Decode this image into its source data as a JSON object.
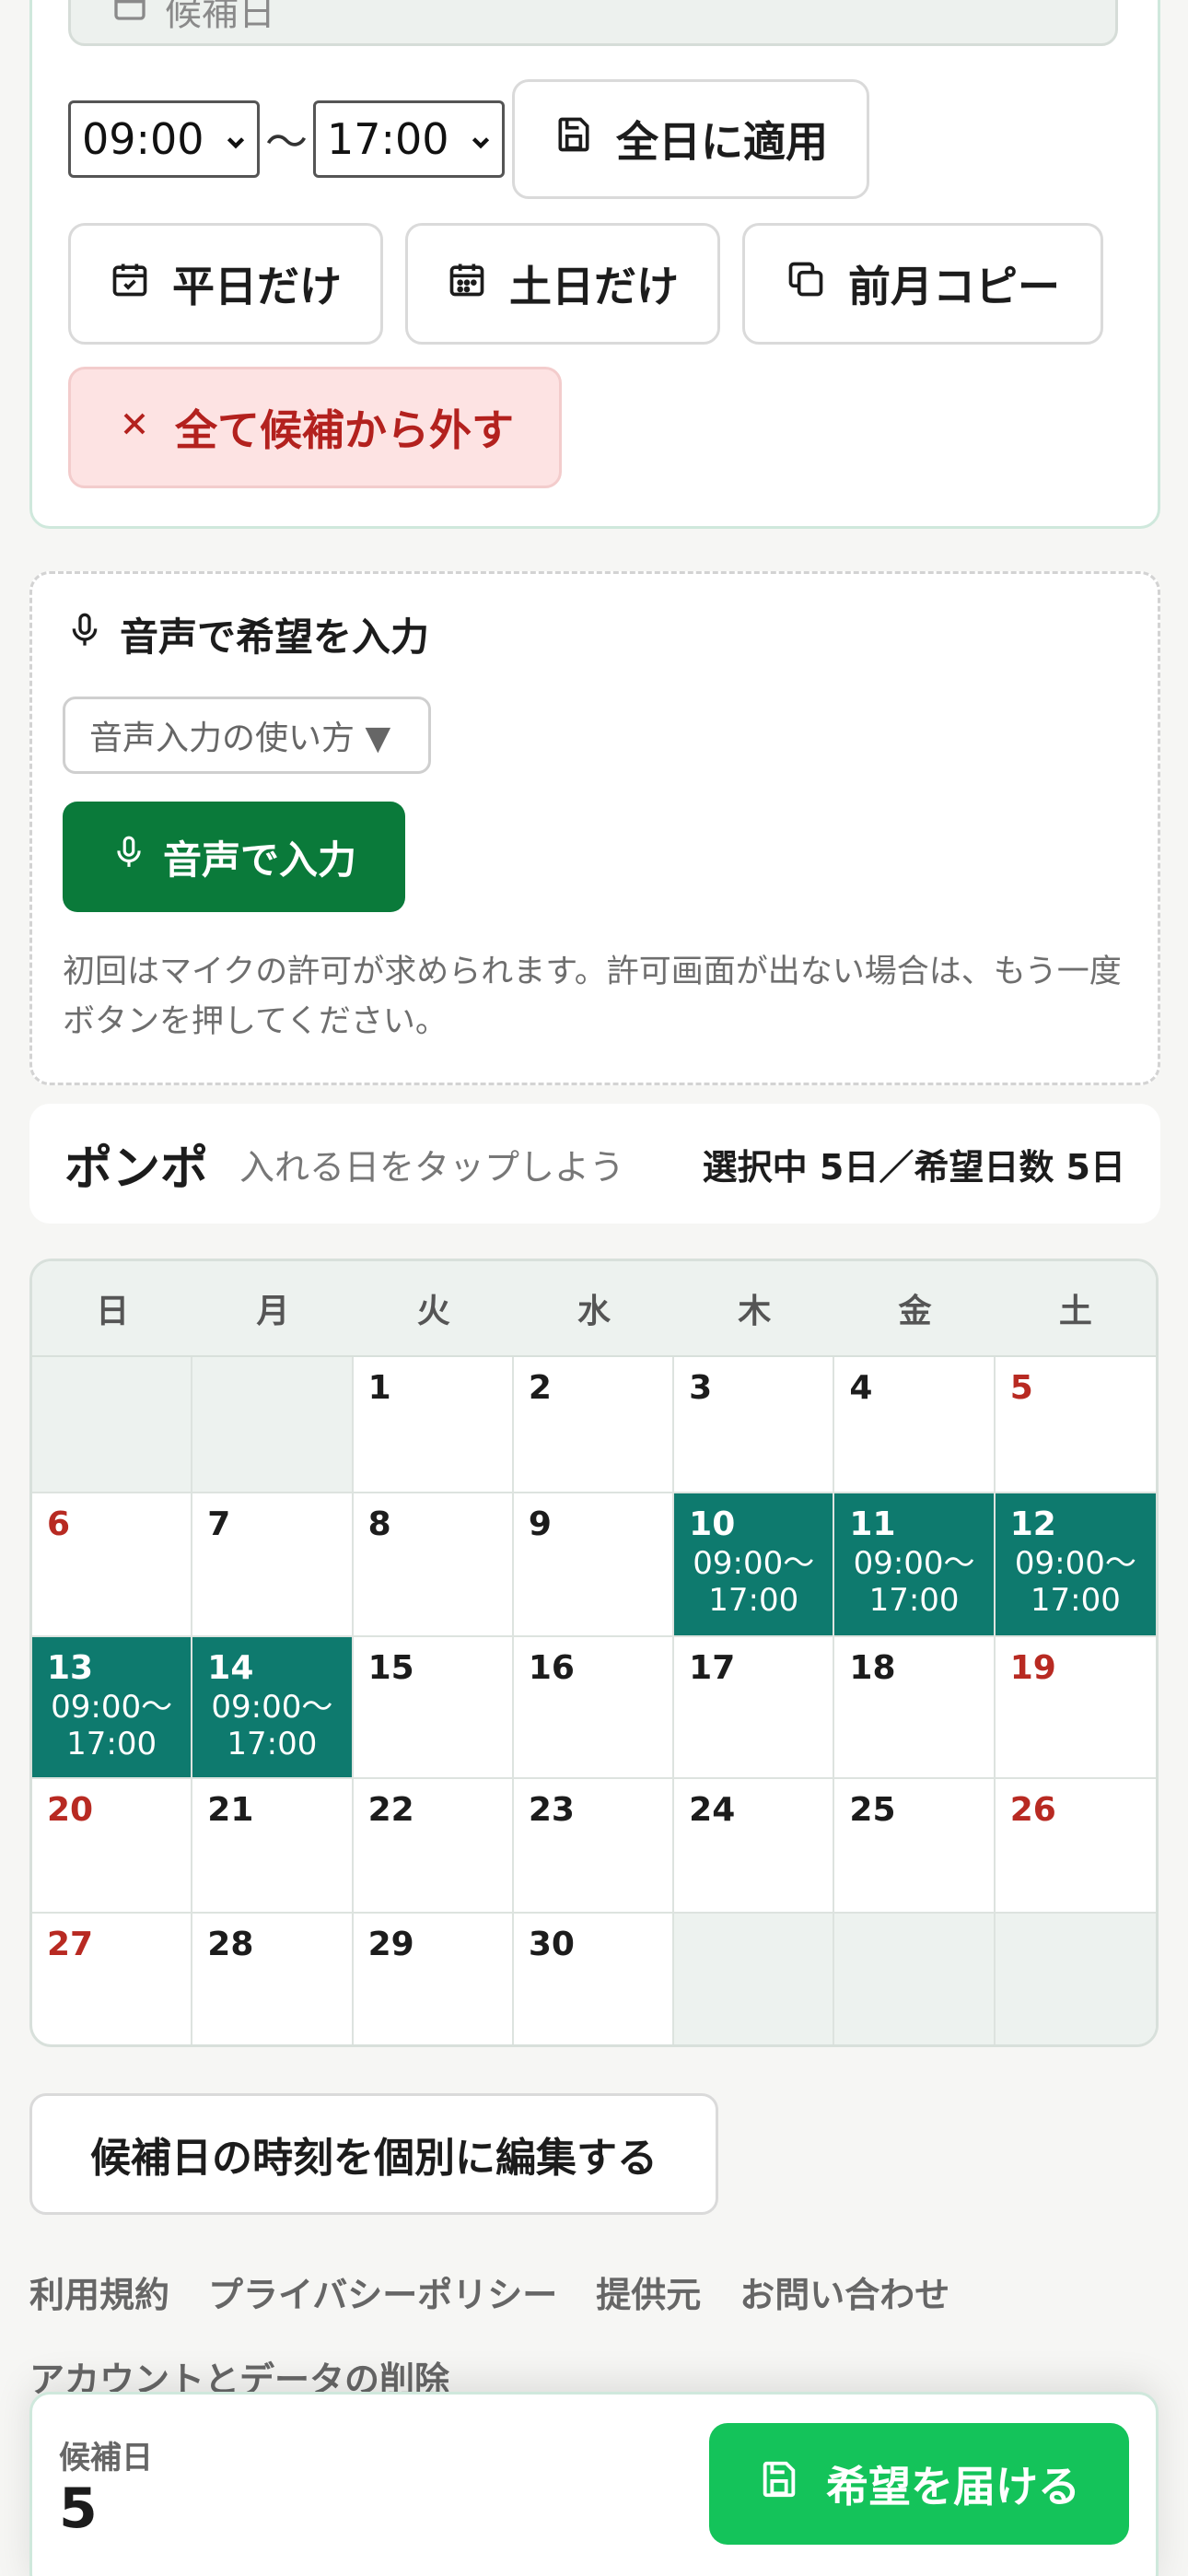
{
  "bulk": {
    "partial_field_text": "候補日",
    "start_time": "09:00",
    "end_time": "17:00",
    "tilde": "〜",
    "apply_all_label": "全日に適用",
    "weekdays_label": "平日だけ",
    "weekends_label": "土日だけ",
    "copy_prev_label": "前月コピー",
    "clear_all_label": "全て候補から外す"
  },
  "voice": {
    "title": "音声で希望を入力",
    "help_label": "音声入力の使い方 ▼",
    "button_label": "音声で入力",
    "note": "初回はマイクの許可が求められます。許可画面が出ない場合は、もう一度ボタンを押してください。"
  },
  "ponpo": {
    "name": "ポンポ",
    "hint": "入れる日をタップしよう",
    "count": "選択中 5日／希望日数 5日"
  },
  "calendar": {
    "weekdays": [
      "日",
      "月",
      "火",
      "水",
      "木",
      "金",
      "土"
    ],
    "cells": [
      {
        "day": "",
        "empty": true
      },
      {
        "day": "",
        "empty": true
      },
      {
        "day": "1"
      },
      {
        "day": "2"
      },
      {
        "day": "3"
      },
      {
        "day": "4"
      },
      {
        "day": "5",
        "red": true
      },
      {
        "day": "6",
        "red": true
      },
      {
        "day": "7"
      },
      {
        "day": "8"
      },
      {
        "day": "9"
      },
      {
        "day": "10",
        "selected": true,
        "slot1": "09:00〜",
        "slot2": "17:00"
      },
      {
        "day": "11",
        "selected": true,
        "slot1": "09:00〜",
        "slot2": "17:00"
      },
      {
        "day": "12",
        "selected": true,
        "slot1": "09:00〜",
        "slot2": "17:00"
      },
      {
        "day": "13",
        "selected": true,
        "red": true,
        "slot1": "09:00〜",
        "slot2": "17:00"
      },
      {
        "day": "14",
        "selected": true,
        "slot1": "09:00〜",
        "slot2": "17:00"
      },
      {
        "day": "15"
      },
      {
        "day": "16"
      },
      {
        "day": "17"
      },
      {
        "day": "18"
      },
      {
        "day": "19",
        "red": true
      },
      {
        "day": "20",
        "red": true
      },
      {
        "day": "21"
      },
      {
        "day": "22"
      },
      {
        "day": "23"
      },
      {
        "day": "24"
      },
      {
        "day": "25"
      },
      {
        "day": "26",
        "red": true
      },
      {
        "day": "27",
        "red": true
      },
      {
        "day": "28"
      },
      {
        "day": "29"
      },
      {
        "day": "30"
      },
      {
        "day": "",
        "empty": true
      },
      {
        "day": "",
        "empty": true
      },
      {
        "day": "",
        "empty": true
      }
    ]
  },
  "edit_button_label": "候補日の時刻を個別に編集する",
  "footer": {
    "links": [
      "利用規約",
      "プライバシーポリシー",
      "提供元",
      "お問い合わせ"
    ],
    "delete_account": "アカウントとデータの削除"
  },
  "bottom_bar": {
    "candidate_label": "候補日",
    "candidate_count": "5",
    "submit_label": "希望を届ける"
  },
  "colors": {
    "accent_green": "#14c35a",
    "dark_green": "#0a7a3a",
    "selected_teal": "#0e7a6e",
    "holiday_red": "#b82a22",
    "danger_bg": "#fde3e3"
  }
}
